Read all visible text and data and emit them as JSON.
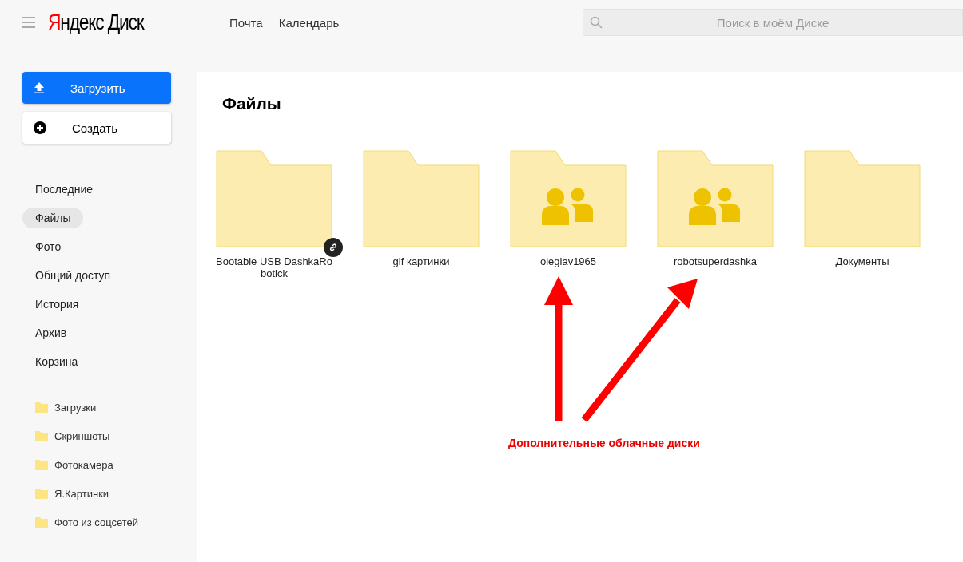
{
  "header": {
    "logo": {
      "brand": "Яндекс",
      "product": "Диск"
    },
    "nav": [
      "Почта",
      "Календарь"
    ],
    "search": {
      "placeholder": "Поиск в моём Диске"
    }
  },
  "sidebar": {
    "upload_button": "Загрузить",
    "create_button": "Создать",
    "items": [
      {
        "label": "Последние",
        "selected": false
      },
      {
        "label": "Файлы",
        "selected": true
      },
      {
        "label": "Фото",
        "selected": false
      },
      {
        "label": "Общий доступ",
        "selected": false
      },
      {
        "label": "История",
        "selected": false
      },
      {
        "label": "Архив",
        "selected": false
      },
      {
        "label": "Корзина",
        "selected": false
      }
    ],
    "folders": [
      "Загрузки",
      "Скриншоты",
      "Фотокамера",
      "Я.Картинки",
      "Фото из соцсетей"
    ]
  },
  "main": {
    "title": "Файлы",
    "folders": [
      {
        "name": "Bootable USB DashkaRo botick",
        "kind": "plain",
        "linked": true
      },
      {
        "name": "gif картинки",
        "kind": "plain",
        "linked": false
      },
      {
        "name": "oleglav1965",
        "kind": "shared",
        "linked": false
      },
      {
        "name": "robotsuperdashka",
        "kind": "shared",
        "linked": false
      },
      {
        "name": "Документы",
        "kind": "plain",
        "linked": false
      }
    ]
  },
  "annotation": {
    "text": "Дополнительные облачные диски"
  }
}
